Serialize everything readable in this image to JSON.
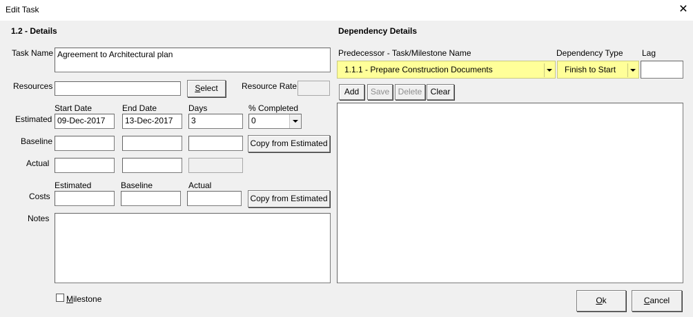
{
  "window": {
    "title": "Edit Task",
    "close_glyph": "✕"
  },
  "details": {
    "title": "1.2 -  Details",
    "task_name_label": "Task Name",
    "task_name_value": "Agreement to Architectural plan",
    "resources_label": "Resources",
    "resources_value": "",
    "select_button": "Select",
    "resource_rate_label": "Resource Rate",
    "resource_rate_value": "",
    "col_start_date": "Start Date",
    "col_end_date": "End Date",
    "col_days": "Days",
    "col_pct_completed": "% Completed",
    "estimated_label": "Estimated",
    "estimated_start": "09-Dec-2017",
    "estimated_end": "13-Dec-2017",
    "estimated_days": "3",
    "pct_completed_value": "0",
    "baseline_label": "Baseline",
    "baseline_start": "",
    "baseline_end": "",
    "baseline_days": "",
    "copy_from_estimated_1": "Copy from Estimated",
    "actual_label": "Actual",
    "actual_start": "",
    "actual_end": "",
    "actual_days": "",
    "costs_col_estimated": "Estimated",
    "costs_col_baseline": "Baseline",
    "costs_col_actual": "Actual",
    "costs_label": "Costs",
    "costs_estimated": "",
    "costs_baseline": "",
    "costs_actual": "",
    "copy_from_estimated_2": "Copy from Estimated",
    "notes_label": "Notes",
    "notes_value": "",
    "milestone_label": "Milestone",
    "milestone_checked": false
  },
  "dependency": {
    "title": "Dependency Details",
    "predecessor_label": "Predecessor - Task/Milestone Name",
    "predecessor_value": "1.1.1 - Prepare Construction Documents",
    "dependency_type_label": "Dependency Type",
    "dependency_type_value": "Finish to Start",
    "lag_label": "Lag",
    "lag_value": "",
    "add_button": "Add",
    "save_button": "Save",
    "delete_button": "Delete",
    "clear_button": "Clear",
    "list_items": []
  },
  "footer": {
    "ok_button": "Ok",
    "cancel_button": "Cancel"
  },
  "colors": {
    "highlight": "#ffff99",
    "window_bg": "#f0f0f0"
  }
}
